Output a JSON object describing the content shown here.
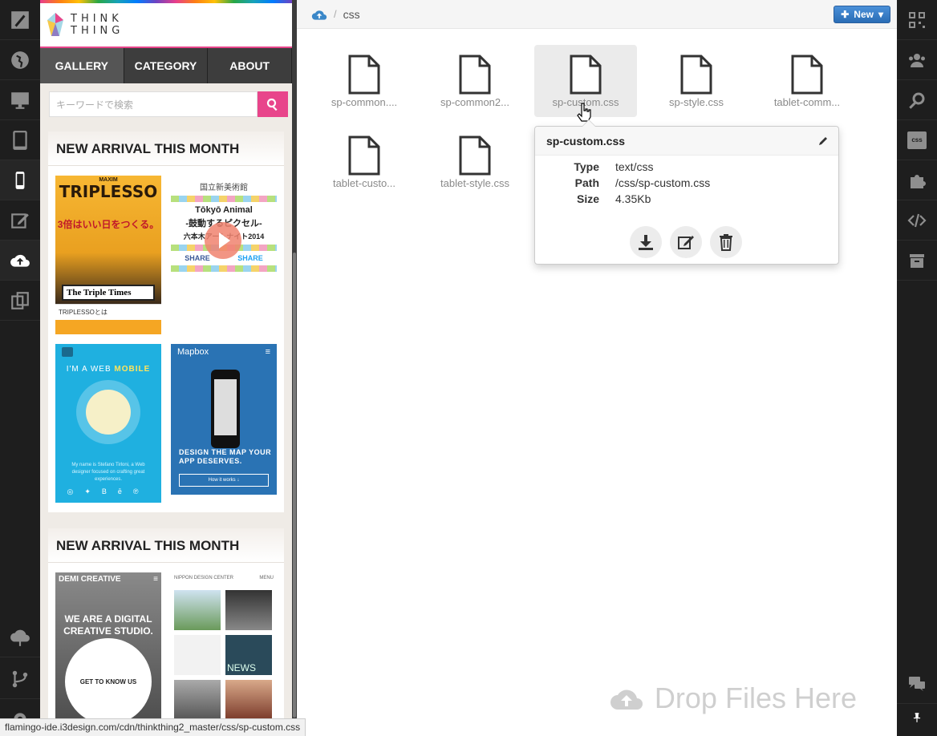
{
  "preview": {
    "logo_text": "THINK THING",
    "nav": [
      "GALLERY",
      "CATEGORY",
      "ABOUT"
    ],
    "search_placeholder": "キーワードで検索",
    "section_title_1": "NEW ARRIVAL THIS MONTH",
    "section_title_2": "NEW ARRIVAL THIS MONTH",
    "thumbs": {
      "t1_brand": "MAXIM",
      "t1_title": "TRIPLESSO",
      "t1_sub": "3倍はいい日をつくる。",
      "t1_paper": "The Triple Times",
      "t1_list_1": "TRIPLESSOとは",
      "t2_head": "国立新美術館",
      "t2_main": "Tōkyō Animal",
      "t2_sub": "-鼓動するピクセル-",
      "t2_date": "六本木アートナイト2014",
      "t2_share_fb": "SHARE",
      "t2_share_tw": "SHARE",
      "t3_head_pre": "I'M A WEB",
      "t3_head_hl": "MOBILE",
      "t3_copy": "My name is Stefano Tirloni, a Web designer focused on crafting great experiences.",
      "t4_brand": "Mapbox",
      "t4_cta": "DESIGN THE MAP YOUR APP DESERVES.",
      "t4_btn": "How it works ↓",
      "t5_brand": "DEMI CREATIVE",
      "t5_big": "WE ARE A DIGITAL CREATIVE STUDIO.",
      "t5_circle": "GET TO KNOW US",
      "t6_brand": "NIPPON DESIGN CENTER",
      "t6_menu": "MENU",
      "t6_news": "NEWS"
    }
  },
  "browser": {
    "breadcrumb_current": "css",
    "new_button": "New",
    "files": [
      {
        "name": "sp-common...."
      },
      {
        "name": "sp-common2..."
      },
      {
        "name": "sp-custom.css"
      },
      {
        "name": "sp-style.css"
      },
      {
        "name": "tablet-comm..."
      },
      {
        "name": "tablet-custo..."
      },
      {
        "name": "tablet-style.css"
      }
    ],
    "popover": {
      "title": "sp-custom.css",
      "type_label": "Type",
      "type_value": "text/css",
      "path_label": "Path",
      "path_value": "/css/sp-custom.css",
      "size_label": "Size",
      "size_value": "4.35Kb"
    },
    "drop_text": "Drop Files Here"
  },
  "right_rail": {
    "css_badge": "css"
  },
  "status_url": "flamingo-ide.i3design.com/cdn/thinkthing2_master/css/sp-custom.css"
}
